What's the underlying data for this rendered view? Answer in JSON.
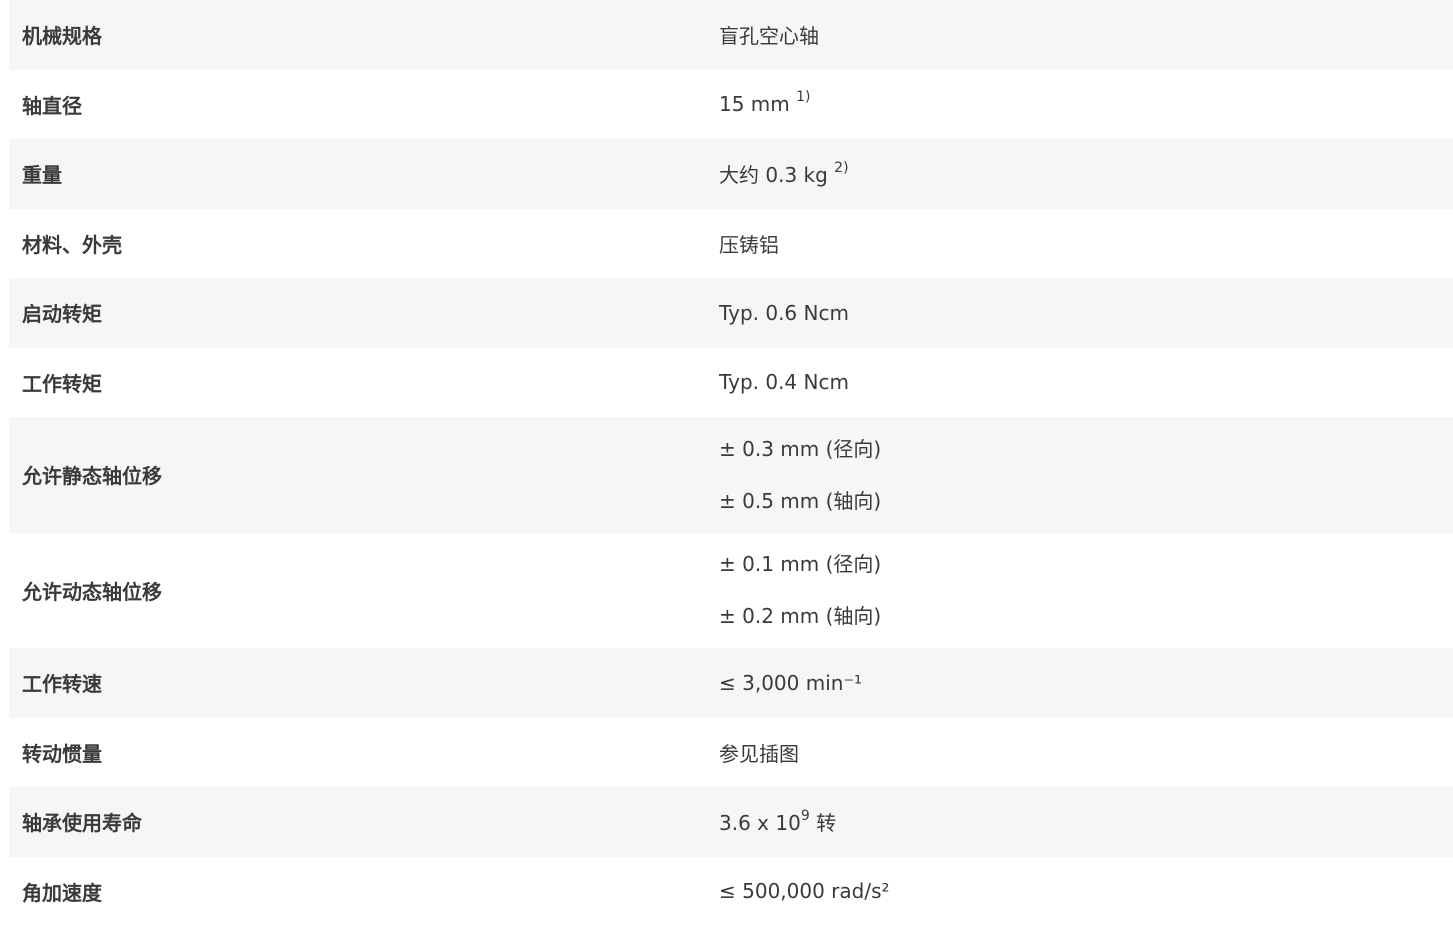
{
  "rows": [
    {
      "label": "机械规格",
      "value": "盲孔空心轴"
    },
    {
      "label": "轴直径",
      "value": "15 mm",
      "sup": "1)"
    },
    {
      "label": "重量",
      "value": "大约 0.3 kg",
      "sup": "2)"
    },
    {
      "label": "材料、外壳",
      "value": "压铸铝"
    },
    {
      "label": "启动转矩",
      "value": "Typ. 0.6 Ncm"
    },
    {
      "label": "工作转矩",
      "value": "Typ. 0.4 Ncm"
    },
    {
      "label": "允许静态轴位移",
      "values": [
        "± 0.3 mm (径向)",
        "± 0.5 mm (轴向)"
      ]
    },
    {
      "label": "允许动态轴位移",
      "values": [
        "± 0.1 mm (径向)",
        "± 0.2 mm (轴向)"
      ]
    },
    {
      "label": "工作转速",
      "value": "≤ 3,000 min⁻¹"
    },
    {
      "label": "转动惯量",
      "value": "参见插图"
    },
    {
      "label": "轴承使用寿命",
      "value": "3.6 x 10",
      "sup": "9",
      "suffix": " 转"
    },
    {
      "label": "角加速度",
      "value": "≤ 500,000 rad/s²"
    }
  ]
}
